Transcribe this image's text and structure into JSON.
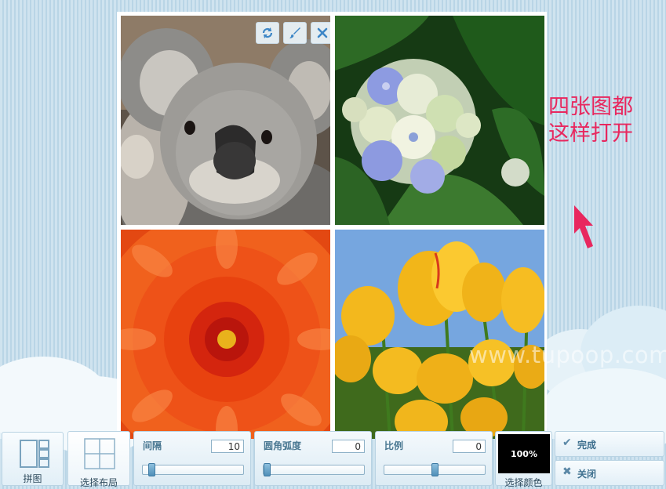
{
  "annotation": {
    "lines": [
      "四张图都",
      "这样打开"
    ],
    "color": "#e8275e"
  },
  "watermark": "www.tupoop.com",
  "cell_tools": [
    {
      "icon": "refresh-icon"
    },
    {
      "icon": "brush-icon"
    },
    {
      "icon": "close-icon"
    }
  ],
  "photos": [
    "koala",
    "hydrangea",
    "chrysanthemum",
    "tulips"
  ],
  "toolbar": {
    "collage_label": "拼图",
    "layout_label": "选择布局",
    "spacing": {
      "label": "间隔",
      "value": "10",
      "slider_fraction": 0.06
    },
    "radius": {
      "label": "圆角弧度",
      "value": "0",
      "slider_fraction": 0.0
    },
    "ratio": {
      "label": "比例",
      "value": "0",
      "slider_fraction": 0.5
    },
    "color": {
      "label": "选择颜色",
      "swatch_text": "100%",
      "swatch_color": "#000000"
    },
    "done_label": "完成",
    "close_label": "关闭"
  }
}
